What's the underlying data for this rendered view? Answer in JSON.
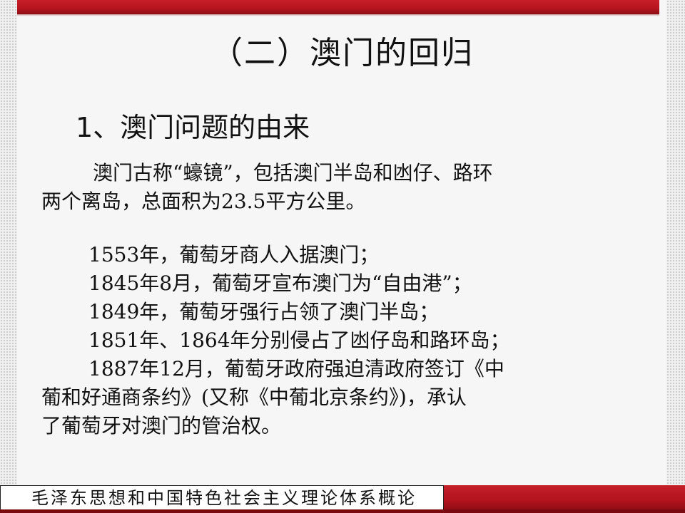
{
  "slide": {
    "title": "（二）澳门的回归",
    "subtitle": "1、澳门问题的由来",
    "intro_line1": "澳门古称“蠔镜”，包括澳门半岛和凼仔、路环",
    "intro_line2": "两个离岛，总面积为23.5平方公里。",
    "events": [
      "1553年，葡萄牙商人入据澳门；",
      "1845年8月，葡萄牙宣布澳门为“自由港”；",
      "1849年，葡萄牙强行占领了澳门半岛；",
      "1851年、1864年分别侵占了凼仔岛和路环岛；",
      "1887年12月，葡萄牙政府强迫清政府签订《中"
    ],
    "event_cont1": "葡和好通商条约》(又称《中葡北京条约》)，承认",
    "event_cont2": "了葡萄牙对澳门的管治权。",
    "footer": "毛泽东思想和中国特色社会主义理论体系概论"
  },
  "colors": {
    "accent_red": "#b5141e",
    "text": "#111111",
    "background": "#f6f6f6"
  }
}
